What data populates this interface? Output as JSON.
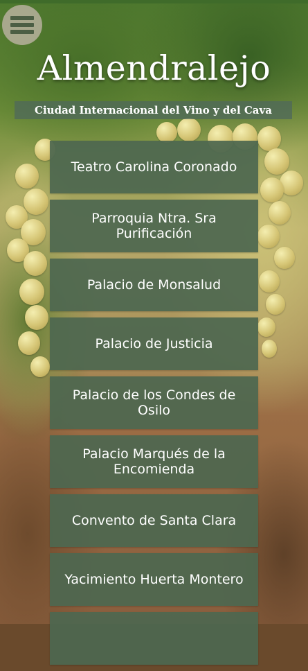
{
  "app": {
    "title": "Almendralejo",
    "subtitle": "Ciudad Internacional del Vino y del Cava"
  },
  "menu_button": {
    "icon": "hamburger-menu-icon"
  },
  "places": [
    {
      "label": "Teatro Carolina Coronado"
    },
    {
      "label": "Parroquia Ntra. Sra Purificación"
    },
    {
      "label": "Palacio de Monsalud"
    },
    {
      "label": "Palacio de Justicia"
    },
    {
      "label": "Palacio de los Condes de Osilo"
    },
    {
      "label": "Palacio Marqués de la Encomienda"
    },
    {
      "label": "Convento de Santa Clara"
    },
    {
      "label": "Yacimiento Huerta Montero"
    }
  ],
  "colors": {
    "item_background": "#4e6750",
    "title_text": "#ffffff",
    "menu_icon": "#4c5e44"
  }
}
